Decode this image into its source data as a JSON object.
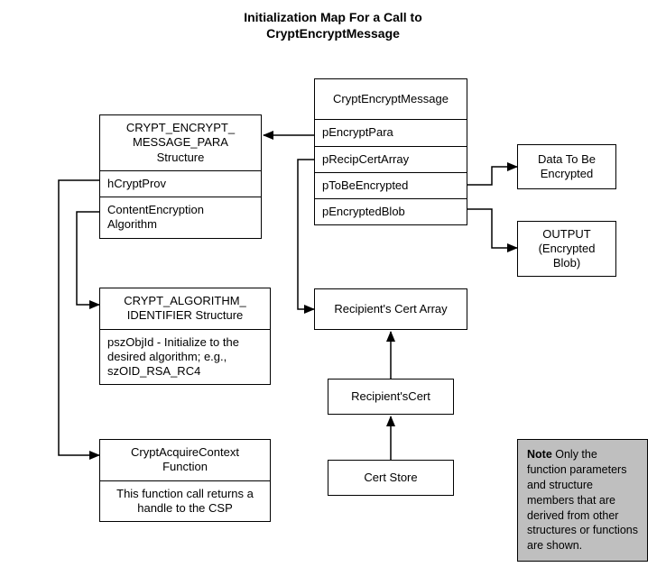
{
  "title_line1": "Initialization Map For a Call to",
  "title_line2": "CryptEncryptMessage",
  "encryptPara": {
    "header": "CRYPT_ENCRYPT_\nMESSAGE_PARA\nStructure",
    "row1": "hCryptProv",
    "row2": "ContentEncryption\nAlgorithm"
  },
  "algId": {
    "header": "CRYPT_ALGORITHM_\nIDENTIFIER Structure",
    "row1": "pszObjId - Initialize to the\ndesired algorithm; e.g.,\nszOID_RSA_RC4"
  },
  "acquire": {
    "header": "CryptAcquireContext\nFunction",
    "row1": "This function call returns a\nhandle to the CSP"
  },
  "mainFn": {
    "header": "CryptEncryptMessage",
    "r1": "pEncryptPara",
    "r2": "pRecipCertArray",
    "r3": "pToBeEncrypted",
    "r4": "pEncryptedBlob"
  },
  "recipArray": "Recipient's Cert Array",
  "recipCert": "Recipient'sCert",
  "certStore": "Cert Store",
  "dataToEnc": "Data To Be\nEncrypted",
  "outputBlob": "OUTPUT\n(Encrypted\nBlob)",
  "note_bold": "Note",
  "note_text": "  Only the function parameters and structure members that are derived from other structures or functions are shown."
}
